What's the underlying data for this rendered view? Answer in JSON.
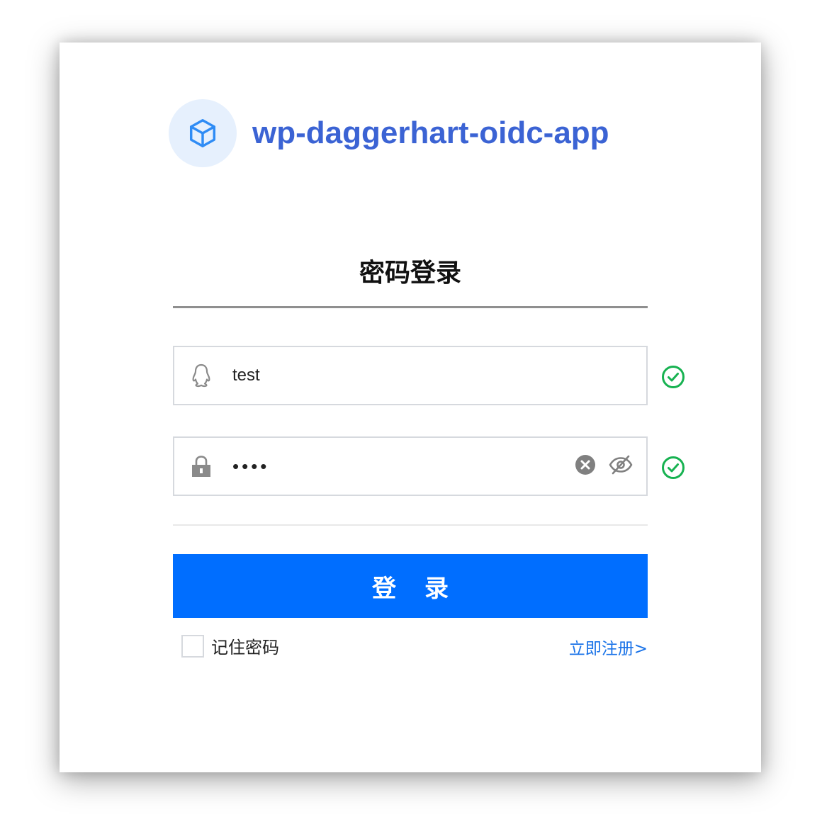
{
  "app": {
    "name": "wp-daggerhart-oidc-app",
    "logo_icon": "cube-icon",
    "brand_color": "#3b63d4"
  },
  "login_tab": {
    "title": "密码登录"
  },
  "username_field": {
    "value": "test",
    "icon": "qq-penguin-icon",
    "valid": true
  },
  "password_field": {
    "value": "••••",
    "icon": "lock-icon",
    "valid": true,
    "clear_icon": "clear-icon",
    "toggle_icon": "eye-off-icon"
  },
  "login_button": {
    "label": "登录",
    "color": "#006eff"
  },
  "remember_password": {
    "label": "记住密码",
    "checked": false
  },
  "register_link": {
    "label": "立即注册>"
  },
  "colors": {
    "valid": "#17b251",
    "link": "#1a73e8"
  }
}
